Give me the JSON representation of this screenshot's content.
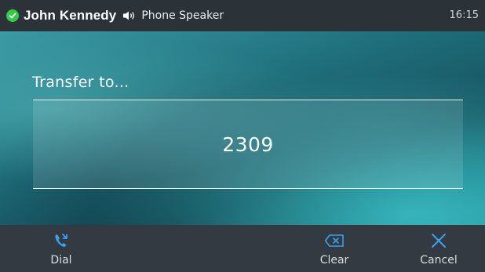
{
  "status_bar": {
    "caller_name": "John Kennedy",
    "audio_mode": "Phone Speaker",
    "time": "16:15",
    "status_icon": "check-circle-icon",
    "audio_icon": "speaker-icon"
  },
  "main": {
    "prompt": "Transfer to...",
    "number": "2309"
  },
  "softkeys": [
    {
      "label": "Dial",
      "icon": "dial-phone-icon"
    },
    {
      "label": "Clear",
      "icon": "backspace-icon"
    },
    {
      "label": "Cancel",
      "icon": "close-icon"
    }
  ],
  "colors": {
    "status_bar_bg": "#2b3238",
    "softkey_bar_bg": "#333a41",
    "accent_blue": "#3aa0f0",
    "status_green": "#37c94a",
    "teal": "#1f6f7c"
  }
}
